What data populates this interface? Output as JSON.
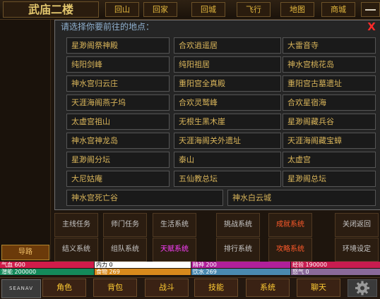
{
  "header": {
    "location_title": "武庙二楼",
    "buttons": [
      "回山",
      "回家",
      "回城",
      "飞行",
      "地图",
      "商城"
    ]
  },
  "dialog": {
    "title": "请选择你要前往的地点：",
    "close": "X",
    "destinations": [
      "星渺阁祭神殿",
      "合欢逍遥居",
      "大雷音寺",
      "纯阳剑峰",
      "纯阳祖居",
      "神水宫桃花岛",
      "神水宫归云庄",
      "重阳宫全真殿",
      "重阳宫古墓遗址",
      "天涯海阁燕子坞",
      "合欢灵鹫峰",
      "合欢星宿海",
      "太虚宫祖山",
      "无根生黑木崖",
      "星渺阁藏兵谷",
      "神水宫神龙岛",
      "天涯海阁关外遗址",
      "天涯海阁藏宝蟑",
      "星渺阁分坛",
      "泰山",
      "太虚宫",
      "大尼姑庵",
      "五仙教总坛",
      "星渺阁总坛",
      "神水宫死亡谷",
      "神水白云城"
    ]
  },
  "left": {
    "button": "导路"
  },
  "grid": [
    {
      "label": "主线任务",
      "color": "#c8c8c8"
    },
    {
      "label": "师门任务",
      "color": "#c8c8c8"
    },
    {
      "label": "生活系统",
      "color": "#c8c8c8"
    },
    {
      "label": "挑战系统",
      "color": "#c8c8c8"
    },
    {
      "label": "成就系统",
      "color": "#ff5a2a"
    },
    {
      "label": "关闭返回",
      "color": "#c8c8c8"
    },
    {
      "label": "结义系统",
      "color": "#c8c8c8"
    },
    {
      "label": "组队系统",
      "color": "#c8c8c8"
    },
    {
      "label": "天赋系统",
      "color": "#ff40ff"
    },
    {
      "label": "排行系统",
      "color": "#c8c8c8"
    },
    {
      "label": "攻略系统",
      "color": "#ff5a2a"
    },
    {
      "label": "环境设定",
      "color": "#c8c8c8"
    }
  ],
  "stats": {
    "hp": "气血 600",
    "mp": "内力 0",
    "spirit": "精神 200",
    "exp": "经验 190000",
    "potential": "潜能 200000",
    "food": "食物 269",
    "water": "饮水 269",
    "anger": "怒气 0"
  },
  "nav": {
    "logo": "SEANAV",
    "tabs": [
      "角色",
      "背包",
      "战斗",
      "技能",
      "系统",
      "聊天"
    ]
  },
  "colors": {
    "hp": "#d01c4a",
    "mp": "#ffffff",
    "spirit": "#b0209a",
    "exp": "#c81c50",
    "potential": "#148a5a",
    "food": "#d88a1c",
    "water": "#4a8ab0",
    "anger": "#8a6a9a"
  }
}
